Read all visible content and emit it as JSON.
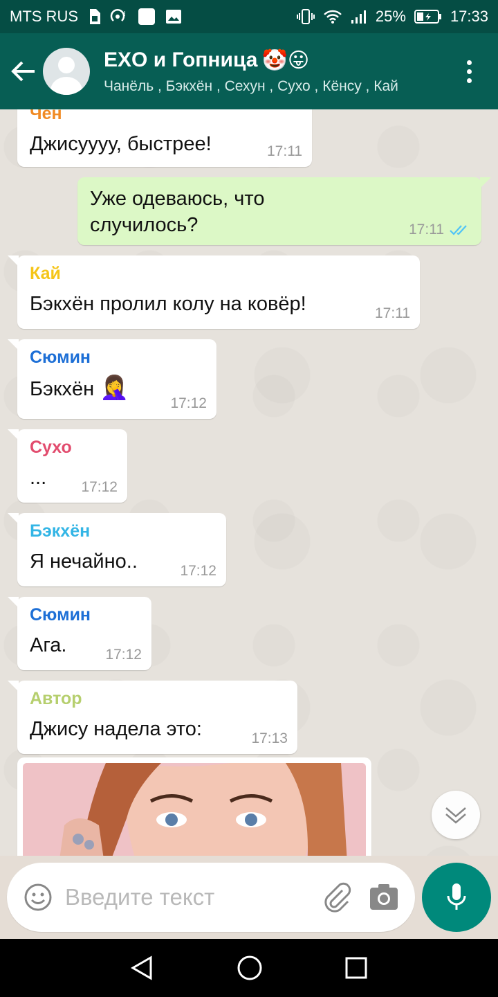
{
  "status_bar": {
    "carrier": "MTS RUS",
    "battery": "25%",
    "time": "17:33"
  },
  "header": {
    "title": "EXO и Гопница",
    "title_emoji": "🤡😛",
    "members": "Чанёль , Бэкхён , Сехун , Сухо , Кёнсу , Кай"
  },
  "messages": [
    {
      "sender": "Чен",
      "sender_color": "#f08a24",
      "text": "Джисуууу, быстрее!",
      "time": "17:11"
    },
    {
      "outgoing": true,
      "text_line1": "Уже одеваюсь, что",
      "text_line2": "случилось?",
      "time": "17:11"
    },
    {
      "sender": "Кай",
      "sender_color": "#f5c518",
      "text": "Бэкхён пролил колу на ковёр!",
      "time": "17:11"
    },
    {
      "sender": "Сюмин",
      "sender_color": "#1d6fd6",
      "text": "Бэкхён",
      "emoji": "🤦‍♀️",
      "time": "17:12"
    },
    {
      "sender": "Сухо",
      "sender_color": "#e24c6e",
      "text": "...",
      "time": "17:12"
    },
    {
      "sender": "Бэкхён",
      "sender_color": "#33b5e5",
      "text": "Я нечайно..",
      "time": "17:12"
    },
    {
      "sender": "Сюмин",
      "sender_color": "#1d6fd6",
      "text": "Ага.",
      "time": "17:12"
    },
    {
      "sender": "Автор",
      "sender_color": "#b6cf6e",
      "text": "Джису надела это:",
      "time": "17:13"
    }
  ],
  "input": {
    "placeholder": "Введите текст"
  },
  "icons": {
    "back": "arrow-left-icon",
    "menu": "more-vert-icon",
    "emoji": "emoji-icon",
    "attach": "paperclip-icon",
    "camera": "camera-icon",
    "mic": "mic-icon",
    "scroll": "chevron-down-icon"
  },
  "colors": {
    "header": "#075e54",
    "status_bar": "#054d44",
    "outgoing_bubble": "#dcf8c6",
    "mic_button": "#00897b",
    "read_ticks": "#4fc3f7"
  }
}
